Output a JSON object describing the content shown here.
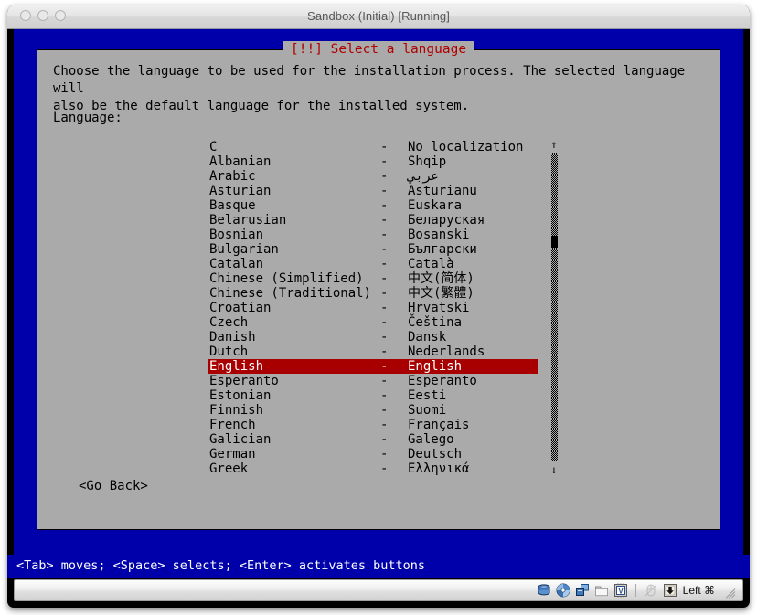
{
  "window": {
    "title": "Sandbox (Initial) [Running]",
    "traffic_lights": [
      "close",
      "minimize",
      "zoom"
    ]
  },
  "colors": {
    "vm_background": "#0000aa",
    "dialog_background": "#aaaaaa",
    "dialog_title_text": "#b00000",
    "selection_background": "#a80000",
    "selection_text": "#ffffff",
    "status_background": "#0000aa",
    "status_text": "#ffffff"
  },
  "dialog": {
    "title": "[!!] Select a language",
    "description": "Choose the language to be used for the installation process. The selected language will\nalso be the default language for the installed system.",
    "field_label": "Language:",
    "separator": "-",
    "go_back_label": "<Go Back>",
    "selected_language": "English"
  },
  "languages": [
    {
      "name": "C",
      "native": "No localization",
      "selected": false
    },
    {
      "name": "Albanian",
      "native": "Shqip",
      "selected": false
    },
    {
      "name": "Arabic",
      "native": "عربي",
      "selected": false
    },
    {
      "name": "Asturian",
      "native": "Asturianu",
      "selected": false
    },
    {
      "name": "Basque",
      "native": "Euskara",
      "selected": false
    },
    {
      "name": "Belarusian",
      "native": "Беларуская",
      "selected": false
    },
    {
      "name": "Bosnian",
      "native": "Bosanski",
      "selected": false
    },
    {
      "name": "Bulgarian",
      "native": "Български",
      "selected": false
    },
    {
      "name": "Catalan",
      "native": "Català",
      "selected": false
    },
    {
      "name": "Chinese (Simplified)",
      "native": "中文(简体)",
      "selected": false
    },
    {
      "name": "Chinese (Traditional)",
      "native": "中文(繁體)",
      "selected": false
    },
    {
      "name": "Croatian",
      "native": "Hrvatski",
      "selected": false
    },
    {
      "name": "Czech",
      "native": "Čeština",
      "selected": false
    },
    {
      "name": "Danish",
      "native": "Dansk",
      "selected": false
    },
    {
      "name": "Dutch",
      "native": "Nederlands",
      "selected": false
    },
    {
      "name": "English",
      "native": "English",
      "selected": true
    },
    {
      "name": "Esperanto",
      "native": "Esperanto",
      "selected": false
    },
    {
      "name": "Estonian",
      "native": "Eesti",
      "selected": false
    },
    {
      "name": "Finnish",
      "native": "Suomi",
      "selected": false
    },
    {
      "name": "French",
      "native": "Français",
      "selected": false
    },
    {
      "name": "Galician",
      "native": "Galego",
      "selected": false
    },
    {
      "name": "German",
      "native": "Deutsch",
      "selected": false
    },
    {
      "name": "Greek",
      "native": "Ελληνικά",
      "selected": false
    }
  ],
  "scrollbar": {
    "up_arrow": "↑",
    "down_arrow": "↓",
    "thumb_position_percent": 28
  },
  "status_line": {
    "text": "<Tab> moves; <Space> selects; <Enter> activates buttons"
  },
  "vbox_statusbar": {
    "icons": [
      "hard-disk-icon",
      "optical-disk-icon",
      "network-icon",
      "shared-folders-icon",
      "display-icon",
      "mouse-icon",
      "host-key-icon"
    ],
    "host_key_label": "Left ⌘"
  }
}
